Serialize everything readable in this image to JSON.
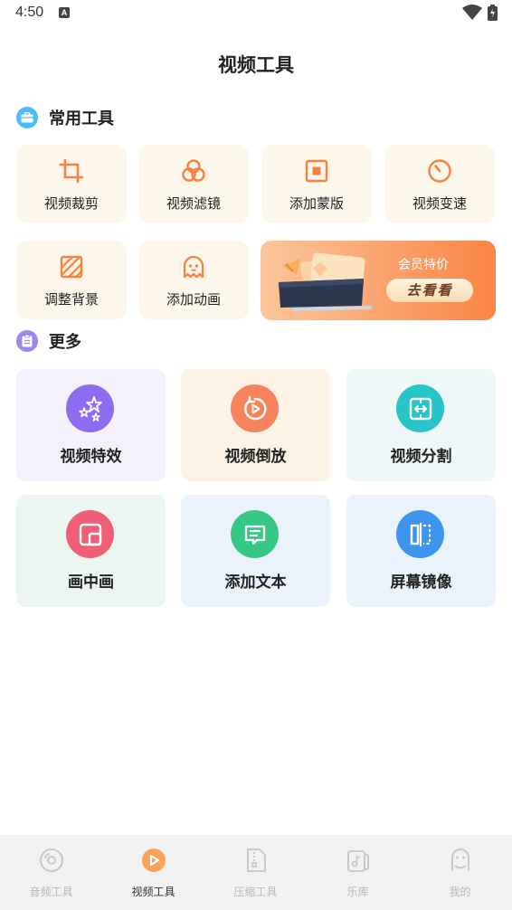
{
  "status_bar": {
    "time": "4:50"
  },
  "header": {
    "title": "视频工具"
  },
  "sections": {
    "common": {
      "label": "常用工具"
    },
    "more": {
      "label": "更多"
    }
  },
  "tools": [
    {
      "label": "视频裁剪",
      "icon": "crop-icon"
    },
    {
      "label": "视频滤镜",
      "icon": "filter-icon"
    },
    {
      "label": "添加蒙版",
      "icon": "mask-icon"
    },
    {
      "label": "视频变速",
      "icon": "speed-icon"
    },
    {
      "label": "调整背景",
      "icon": "background-icon"
    },
    {
      "label": "添加动画",
      "icon": "ghost-icon"
    }
  ],
  "banner": {
    "title": "会员特价",
    "button": "去看看"
  },
  "more_tools": [
    {
      "label": "视频特效",
      "icon": "stars-icon",
      "bg": "#f4f1fd",
      "circle": "#8d6cf2"
    },
    {
      "label": "视频倒放",
      "icon": "reverse-icon",
      "bg": "#fdf3e4",
      "circle": "#f7835c"
    },
    {
      "label": "视频分割",
      "icon": "split-icon",
      "bg": "#eef8f9",
      "circle": "#28c4c7"
    },
    {
      "label": "画中画",
      "icon": "pip-icon",
      "bg": "#ebf6f0",
      "circle": "#ef5f78"
    },
    {
      "label": "添加文本",
      "icon": "text-icon",
      "bg": "#eaf2fb",
      "circle": "#37c886"
    },
    {
      "label": "屏幕镜像",
      "icon": "mirror-icon",
      "bg": "#eaf2fb",
      "circle": "#3e95ef"
    }
  ],
  "nav": [
    {
      "label": "音频工具",
      "icon": "audio-icon",
      "active": false
    },
    {
      "label": "视频工具",
      "icon": "video-icon",
      "active": true
    },
    {
      "label": "压缩工具",
      "icon": "compress-icon",
      "active": false
    },
    {
      "label": "乐库",
      "icon": "music-library-icon",
      "active": false
    },
    {
      "label": "我的",
      "icon": "profile-icon",
      "active": false
    }
  ],
  "colors": {
    "accent": "#f5823e",
    "tool_card_bg": "#fdf6ea",
    "nav_active": "#f9a25e",
    "nav_inactive": "#c9c9c9"
  }
}
